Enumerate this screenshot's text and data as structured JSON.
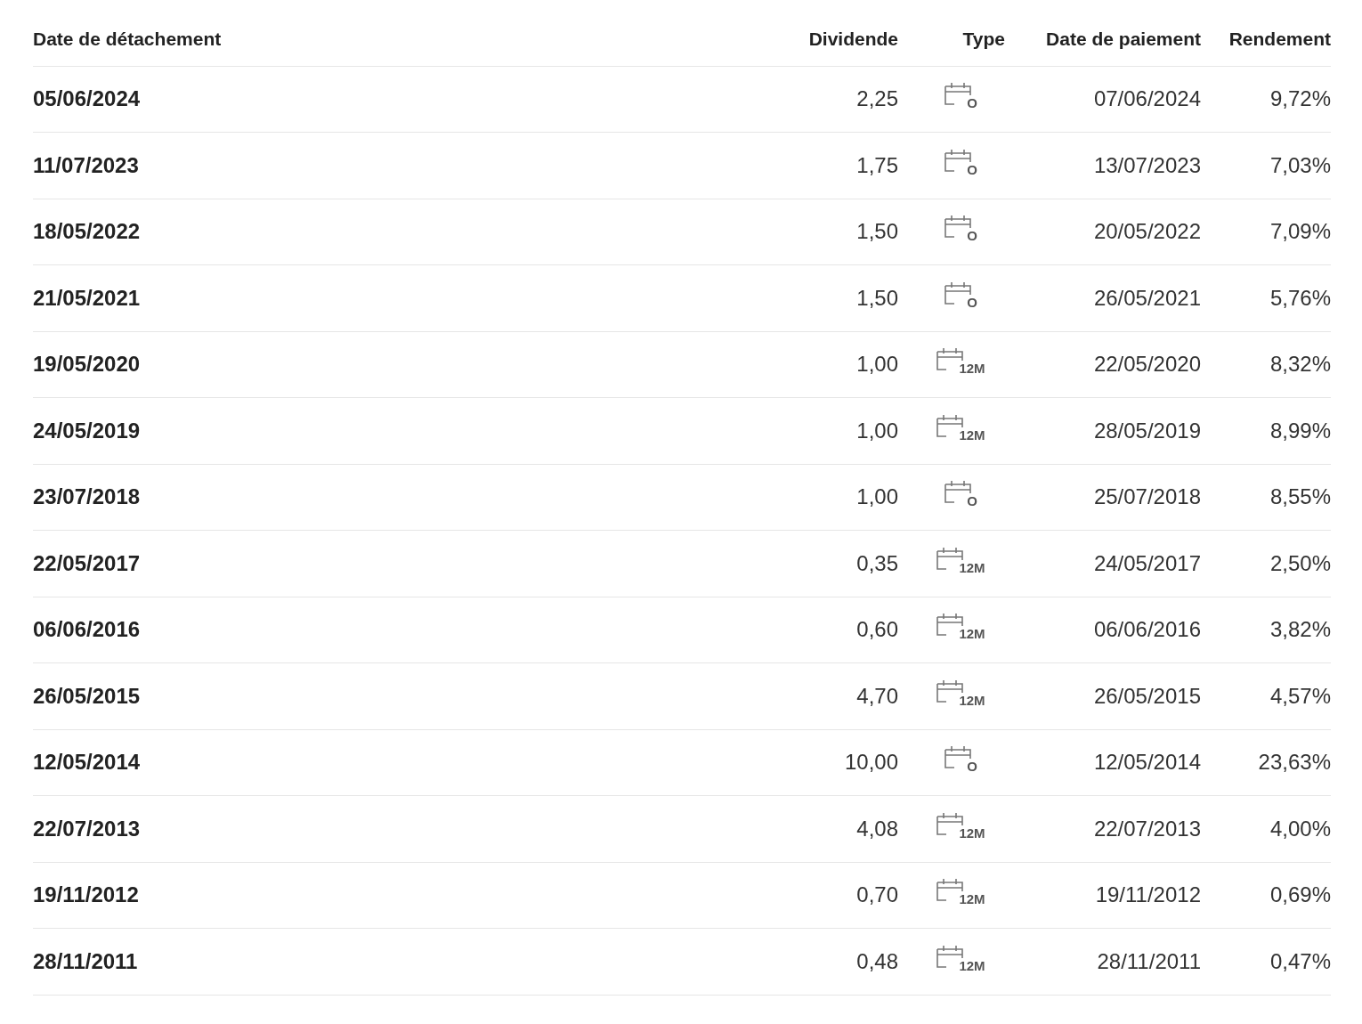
{
  "table": {
    "columns": [
      "Date de détachement",
      "Dividende",
      "Type",
      "Date de paiement",
      "Rendement"
    ],
    "rows": [
      {
        "date": "05/06/2024",
        "dividend": "2,25",
        "type": "O",
        "payment": "07/06/2024",
        "yield": "9,72%"
      },
      {
        "date": "11/07/2023",
        "dividend": "1,75",
        "type": "O",
        "payment": "13/07/2023",
        "yield": "7,03%"
      },
      {
        "date": "18/05/2022",
        "dividend": "1,50",
        "type": "O",
        "payment": "20/05/2022",
        "yield": "7,09%"
      },
      {
        "date": "21/05/2021",
        "dividend": "1,50",
        "type": "O",
        "payment": "26/05/2021",
        "yield": "5,76%"
      },
      {
        "date": "19/05/2020",
        "dividend": "1,00",
        "type": "12M",
        "payment": "22/05/2020",
        "yield": "8,32%"
      },
      {
        "date": "24/05/2019",
        "dividend": "1,00",
        "type": "12M",
        "payment": "28/05/2019",
        "yield": "8,99%"
      },
      {
        "date": "23/07/2018",
        "dividend": "1,00",
        "type": "O",
        "payment": "25/07/2018",
        "yield": "8,55%"
      },
      {
        "date": "22/05/2017",
        "dividend": "0,35",
        "type": "12M",
        "payment": "24/05/2017",
        "yield": "2,50%"
      },
      {
        "date": "06/06/2016",
        "dividend": "0,60",
        "type": "12M",
        "payment": "06/06/2016",
        "yield": "3,82%"
      },
      {
        "date": "26/05/2015",
        "dividend": "4,70",
        "type": "12M",
        "payment": "26/05/2015",
        "yield": "4,57%"
      },
      {
        "date": "12/05/2014",
        "dividend": "10,00",
        "type": "O",
        "payment": "12/05/2014",
        "yield": "23,63%"
      },
      {
        "date": "22/07/2013",
        "dividend": "4,08",
        "type": "12M",
        "payment": "22/07/2013",
        "yield": "4,00%"
      },
      {
        "date": "19/11/2012",
        "dividend": "0,70",
        "type": "12M",
        "payment": "19/11/2012",
        "yield": "0,69%"
      },
      {
        "date": "28/11/2011",
        "dividend": "0,48",
        "type": "12M",
        "payment": "28/11/2011",
        "yield": "0,47%"
      }
    ]
  }
}
